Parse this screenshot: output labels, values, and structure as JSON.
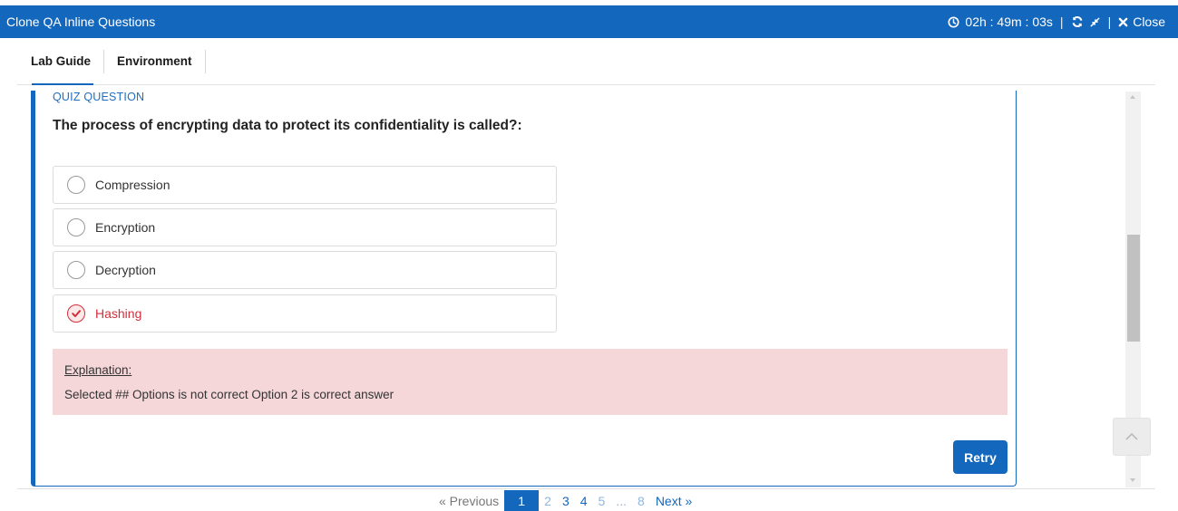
{
  "window": {
    "title": "Clone QA Inline Questions",
    "timer": "02h : 49m : 03s",
    "separator": "|",
    "close_label": "Close"
  },
  "tabs": [
    {
      "label": "Lab Guide",
      "active": true
    },
    {
      "label": "Environment",
      "active": false
    }
  ],
  "quiz": {
    "label": "QUIZ QUESTION",
    "question": "The process of encrypting data to protect its confidentiality is called?:",
    "options": [
      {
        "label": "Compression",
        "selected": false
      },
      {
        "label": "Encryption",
        "selected": false
      },
      {
        "label": "Decryption",
        "selected": false
      },
      {
        "label": "Hashing",
        "selected": true
      }
    ],
    "explanation": {
      "title": "Explanation:",
      "text": "Selected ## Options is not correct Option 2 is correct answer"
    },
    "retry_label": "Retry"
  },
  "pagination": {
    "previous": "« Previous",
    "pages": [
      "1",
      "2",
      "3",
      "4",
      "5",
      "...",
      "8"
    ],
    "current": "1",
    "next": "Next »"
  },
  "colors": {
    "brand": "#1367bd",
    "error": "#d0303a",
    "explanation_bg": "#f5d7d9"
  }
}
